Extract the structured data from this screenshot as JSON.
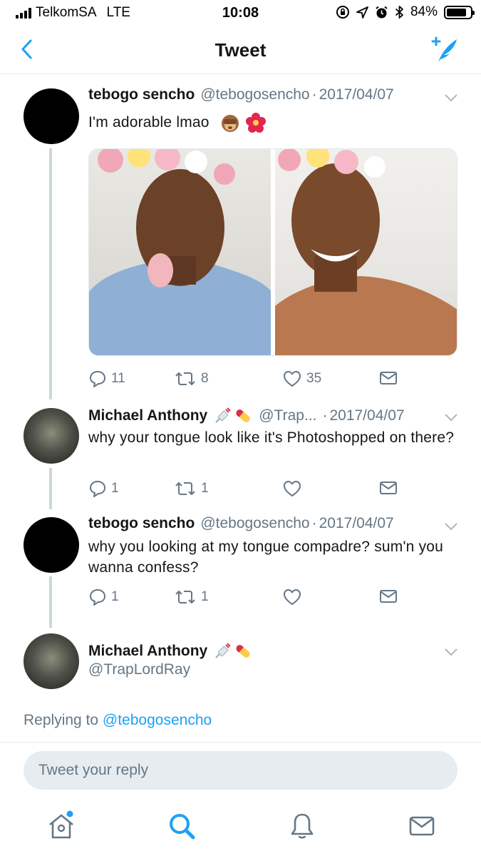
{
  "status_bar": {
    "carrier": "TelkomSA",
    "network": "LTE",
    "time": "10:08",
    "battery": "84%",
    "battery_level": 0.84
  },
  "header": {
    "title": "Tweet",
    "back_icon": "chevron-left-icon",
    "compose_icon": "compose-tweet-icon"
  },
  "colors": {
    "accent": "#1da1f2",
    "secondary_text": "#657786",
    "divider": "#e1e8ed"
  },
  "tweets": [
    {
      "name": "tebogo sencho",
      "handle": "@tebogosencho",
      "date": "2017/04/07",
      "text": "I'm adorable lmao",
      "emojis": [
        "see-no-evil-monkey",
        "hibiscus"
      ],
      "replies": "11",
      "retweets": "8",
      "likes": "35"
    },
    {
      "name": "Michael Anthony",
      "name_emojis": [
        "syringe",
        "pill"
      ],
      "handle": "@Trap...",
      "date": "2017/04/07",
      "text": "why your tongue look like it's Photoshopped on there?",
      "replies": "1",
      "retweets": "1",
      "likes": ""
    },
    {
      "name": "tebogo sencho",
      "handle": "@tebogosencho",
      "date": "2017/04/07",
      "text": "why you looking at my tongue compadre? sum'n you wanna confess?",
      "replies": "1",
      "retweets": "1",
      "likes": ""
    },
    {
      "name": "Michael Anthony",
      "name_emojis": [
        "syringe",
        "pill"
      ],
      "handle": "@TrapLordRay"
    }
  ],
  "replying": {
    "prefix": "Replying to",
    "mention": "@tebogosencho"
  },
  "reply_input": {
    "placeholder": "Tweet your reply",
    "value": ""
  },
  "tabbar": [
    "home-icon",
    "search-icon",
    "notifications-icon",
    "messages-icon"
  ]
}
